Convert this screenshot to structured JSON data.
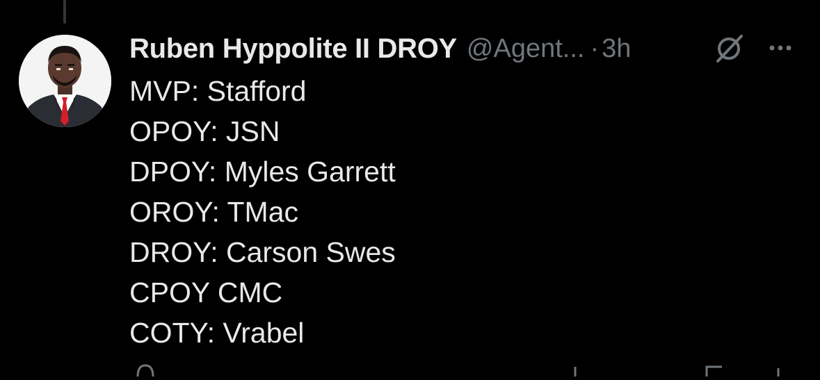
{
  "post": {
    "author": {
      "display_name": "Ruben Hyppolite II DROY",
      "handle": "@Agent...",
      "separator": "·",
      "timestamp": "3h"
    },
    "lines": [
      "MVP: Stafford",
      "OPOY: JSN",
      "DPOY: Myles Garrett",
      "OROY: TMac",
      "DROY: Carson Swes",
      "CPOY CMC",
      "COTY: Vrabel"
    ],
    "icons": {
      "grok": "grok-icon",
      "more": "more-icon",
      "avatar": "avatar"
    }
  },
  "colors": {
    "background": "#000000",
    "primary_text": "#e7e9ea",
    "secondary_text": "#71767b",
    "thread_line": "#333639"
  }
}
